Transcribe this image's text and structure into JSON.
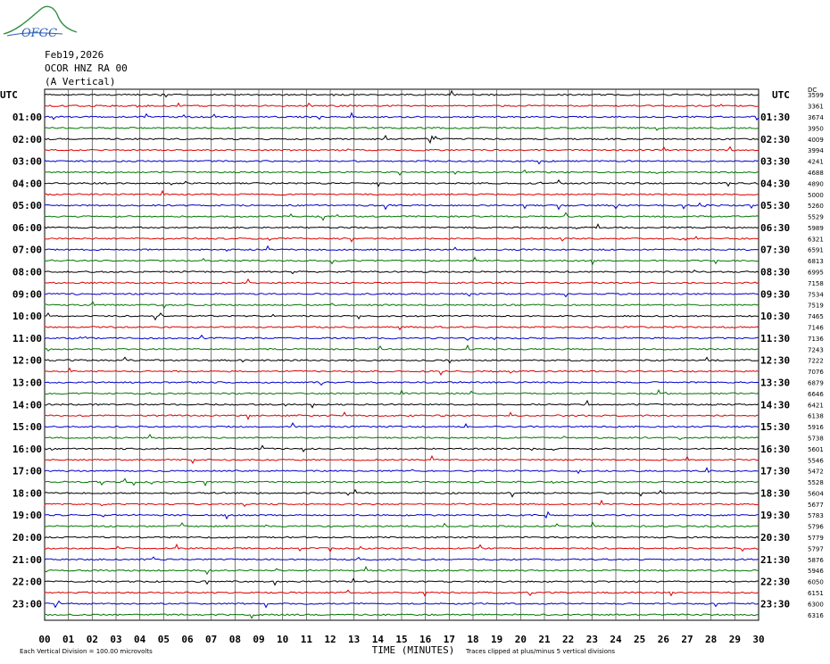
{
  "header": {
    "logo_text": "OFGC",
    "date": "Feb19,2026",
    "station": "OCOR HNZ RA 00",
    "component": "(A Vertical)"
  },
  "chart_data": {
    "type": "seismogram",
    "left_axis_title": "UTC",
    "right_axis_title": "UTC",
    "right_corner_label": "DC",
    "left_time_labels": [
      "01:00",
      "02:00",
      "03:00",
      "04:00",
      "05:00",
      "06:00",
      "07:00",
      "08:00",
      "09:00",
      "10:00",
      "11:00",
      "12:00",
      "13:00",
      "14:00",
      "15:00",
      "16:00",
      "17:00",
      "18:00",
      "19:00",
      "20:00",
      "21:00",
      "22:00",
      "23:00"
    ],
    "right_time_labels": [
      "01:30",
      "02:30",
      "03:30",
      "04:30",
      "05:30",
      "06:30",
      "07:30",
      "08:30",
      "09:30",
      "10:30",
      "11:30",
      "12:30",
      "13:30",
      "14:30",
      "15:30",
      "16:30",
      "17:30",
      "18:30",
      "19:30",
      "20:30",
      "21:30",
      "22:30",
      "23:30"
    ],
    "trace_counts": [
      "3599",
      "3361",
      "3674",
      "3950",
      "4009",
      "3994",
      "4241",
      "4688",
      "4890",
      "5000",
      "5260",
      "5529",
      "5989",
      "6321",
      "6591",
      "6813",
      "6995",
      "7158",
      "7534",
      "7519",
      "7465",
      "7146",
      "7136",
      "7243",
      "7222",
      "7076",
      "6879",
      "6646",
      "6421",
      "6138",
      "5916",
      "5738",
      "5601",
      "5546",
      "5472",
      "5528",
      "5604",
      "5677",
      "5783",
      "5796",
      "5779",
      "5797",
      "5876",
      "5946",
      "6050",
      "6151",
      "6300",
      "6316"
    ],
    "trace_color_cycle": [
      "#000000",
      "#dd0000",
      "#0000cc",
      "#007700"
    ],
    "x_axis": {
      "label": "TIME (MINUTES)",
      "range": [
        0,
        30
      ],
      "tick_labels": [
        "00",
        "01",
        "02",
        "03",
        "04",
        "05",
        "06",
        "07",
        "08",
        "09",
        "10",
        "11",
        "12",
        "13",
        "14",
        "15",
        "16",
        "17",
        "18",
        "19",
        "20",
        "21",
        "22",
        "23",
        "24",
        "25",
        "26",
        "27",
        "28",
        "29",
        "30"
      ]
    },
    "grid": true,
    "notes": {
      "scale": "Each Vertical Division =  100.00 microvolts",
      "clip": "Traces clipped at plus/minus 5 vertical divisions"
    }
  }
}
